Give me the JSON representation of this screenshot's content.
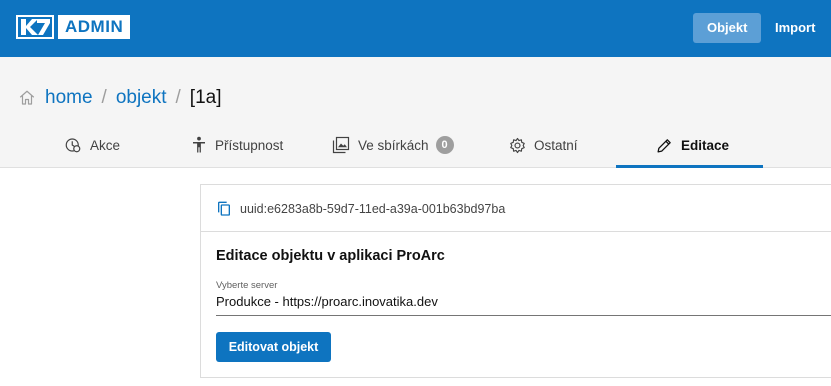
{
  "app": {
    "logo_mark": "K7",
    "logo_text": "ADMIN",
    "brand_color": "#0e74c0"
  },
  "topnav": {
    "items": [
      {
        "label": "Objekt",
        "active": true
      },
      {
        "label": "Import",
        "active": false
      }
    ]
  },
  "breadcrumb": {
    "home_icon": "home-icon",
    "home": "home",
    "separator": "/",
    "objekt": "objekt",
    "current": "[1a]"
  },
  "tabs": [
    {
      "label": "Akce",
      "icon": "clock-icon",
      "active": false
    },
    {
      "label": "Přístupnost",
      "icon": "person-icon",
      "active": false
    },
    {
      "label": "Ve sbírkách",
      "icon": "collections-icon",
      "active": false,
      "badge": "0"
    },
    {
      "label": "Ostatní",
      "icon": "gear-icon",
      "active": false
    },
    {
      "label": "Editace",
      "icon": "pencil-icon",
      "active": true
    }
  ],
  "uuid": {
    "icon": "copy-icon",
    "value": "uuid:e6283a8b-59d7-11ed-a39a-001b63bd97ba"
  },
  "edit": {
    "title": "Editace objektu v aplikaci ProArc",
    "server_label": "Vyberte server",
    "server_value": "Produkce - https://proarc.inovatika.dev",
    "button_label": "Editovat objekt"
  }
}
